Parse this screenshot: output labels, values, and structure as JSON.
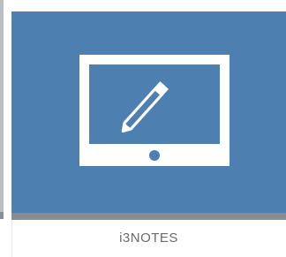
{
  "tile": {
    "label": "i3NOTES",
    "icon": "tablet-pen-icon"
  },
  "colors": {
    "tile_background": "#4d7fb0",
    "tile_bar": "#8a8c8f",
    "icon": "#ffffff",
    "label": "#6b6b6b"
  }
}
